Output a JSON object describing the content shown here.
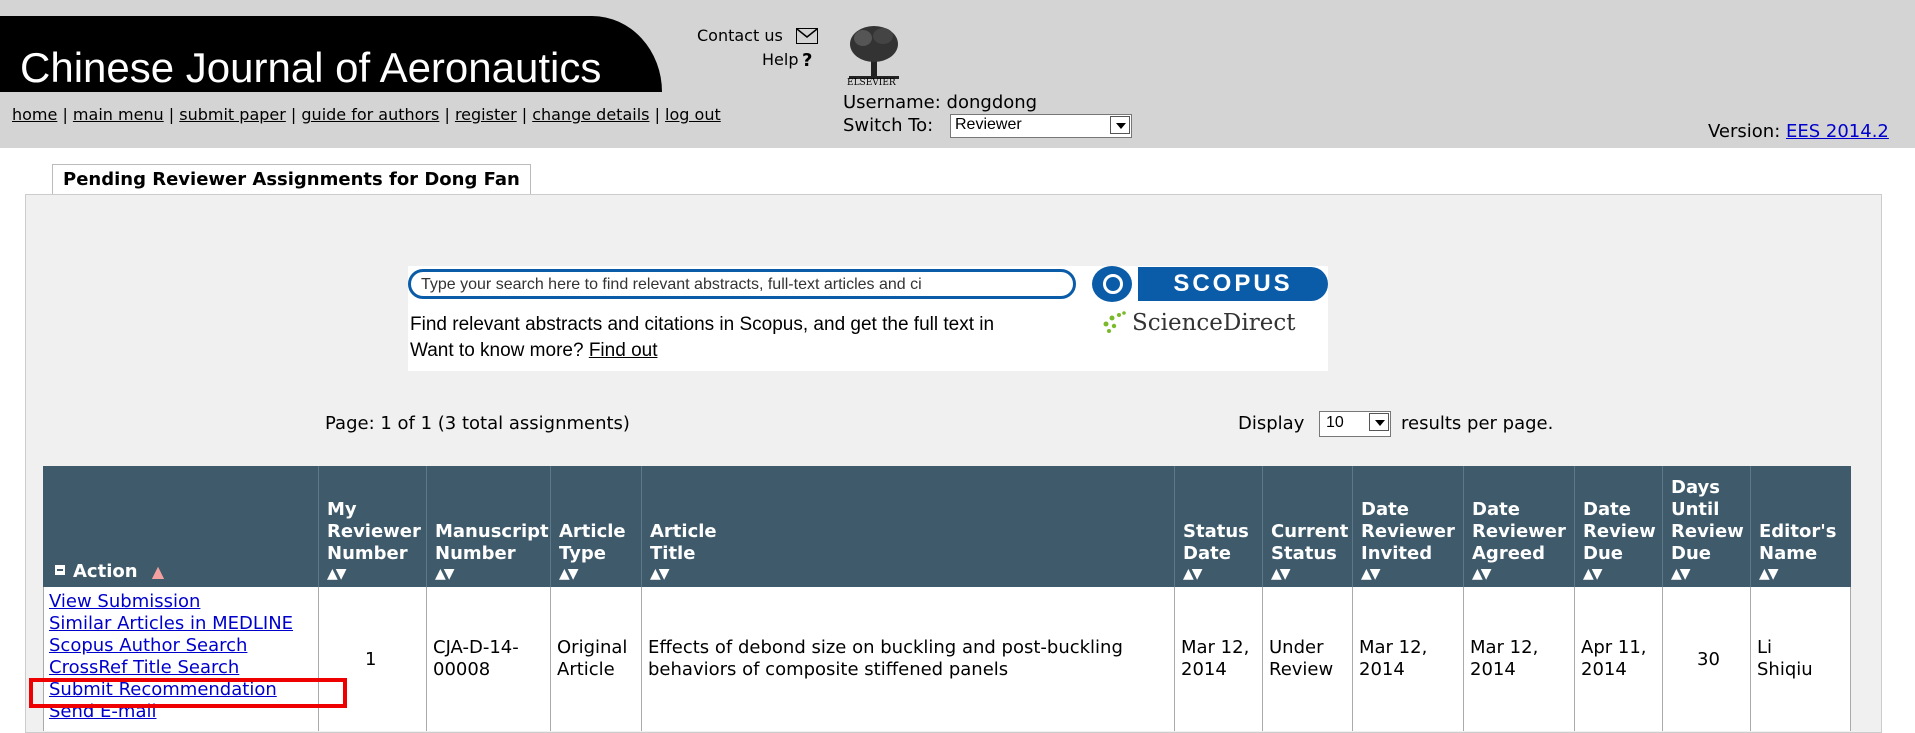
{
  "header": {
    "journal_title": "Chinese Journal of Aeronautics",
    "contact_label": "Contact us",
    "help_label": "Help",
    "help_glyph": "?",
    "publisher_logo_text": "ELSEVIER",
    "username_label": "Username: dongdong",
    "switch_label": "Switch To:",
    "switch_value": "Reviewer",
    "version_label": "Version:",
    "version_value": "EES 2014.2",
    "nav": [
      "home",
      "main menu",
      "submit paper",
      "guide for authors",
      "register",
      "change details",
      "log out"
    ]
  },
  "tab": {
    "label": "Pending Reviewer Assignments for Dong Fan"
  },
  "scopus": {
    "search_placeholder": "Type your search here to find relevant abstracts, full-text articles and ci",
    "logo_text": "SCOPUS",
    "line1": "Find relevant abstracts and citations in Scopus, and get the full text in",
    "sd_text": "ScienceDirect",
    "line2_prefix": "Want to know more?",
    "line2_link": "Find out"
  },
  "paging": {
    "page_info": "Page: 1 of 1 (3 total assignments)",
    "display_label": "Display",
    "display_value": "10",
    "display_suffix": "results per page."
  },
  "table": {
    "headers": [
      "Action",
      "My Reviewer Number",
      "Manuscript Number",
      "Article Type",
      "Article Title",
      "Status Date",
      "Current Status",
      "Date Reviewer Invited",
      "Date Reviewer Agreed",
      "Date Review Due",
      "Days Until Review Due",
      "Editor's Name"
    ],
    "row": {
      "actions": [
        "View Submission",
        "Similar Articles in MEDLINE",
        "Scopus Author Search",
        "CrossRef Title Search",
        "Submit Recommendation",
        "Send E-mail"
      ],
      "reviewer_number": "1",
      "manuscript_number": "CJA-D-14-\n00008",
      "article_type": "Original\nArticle",
      "article_title": "Effects of debond size on buckling and post-buckling\nbehaviors of composite stiffened panels",
      "status_date": "Mar 12,\n2014",
      "current_status": "Under\nReview",
      "date_invited": "Mar 12,\n2014",
      "date_agreed": "Mar 12,\n2014",
      "date_due": "Apr 11,\n2014",
      "days_until_due": "30",
      "editor_name": "Li\nShiqiu"
    }
  },
  "icons": {
    "mail": "envelope-icon",
    "logo": "elsevier-tree-icon",
    "search": "magnifier-icon",
    "sort": "sort-arrows-icon",
    "collapse": "minus-box-icon",
    "warning": "warning-triangle-icon"
  }
}
